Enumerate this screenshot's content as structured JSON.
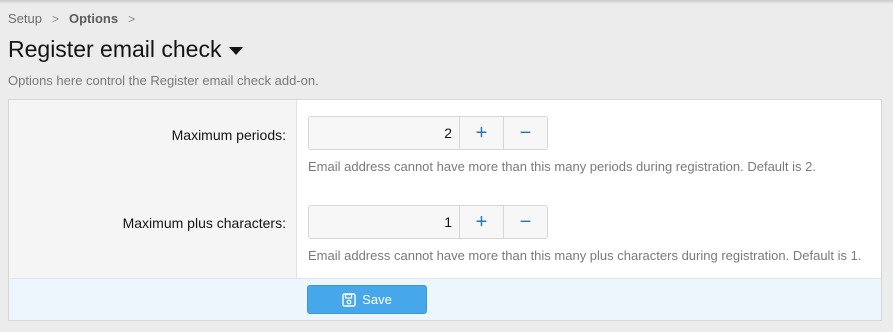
{
  "breadcrumb": {
    "items": [
      "Setup",
      "Options"
    ],
    "separator": ">"
  },
  "page": {
    "title": "Register email check",
    "description": "Options here control the Register email check add-on."
  },
  "options": [
    {
      "label": "Maximum periods:",
      "value": "2",
      "increment": "+",
      "decrement": "−",
      "hint": "Email address cannot have more than this many periods during registration. Default is 2."
    },
    {
      "label": "Maximum plus characters:",
      "value": "1",
      "increment": "+",
      "decrement": "−",
      "hint": "Email address cannot have more than this many plus characters during registration. Default is 1."
    }
  ],
  "footer": {
    "save_label": "Save",
    "save_icon": "save-icon"
  },
  "colors": {
    "accent": "#47a7eb",
    "stepper": "#2577b1",
    "footer_bg": "#edf6fd"
  }
}
